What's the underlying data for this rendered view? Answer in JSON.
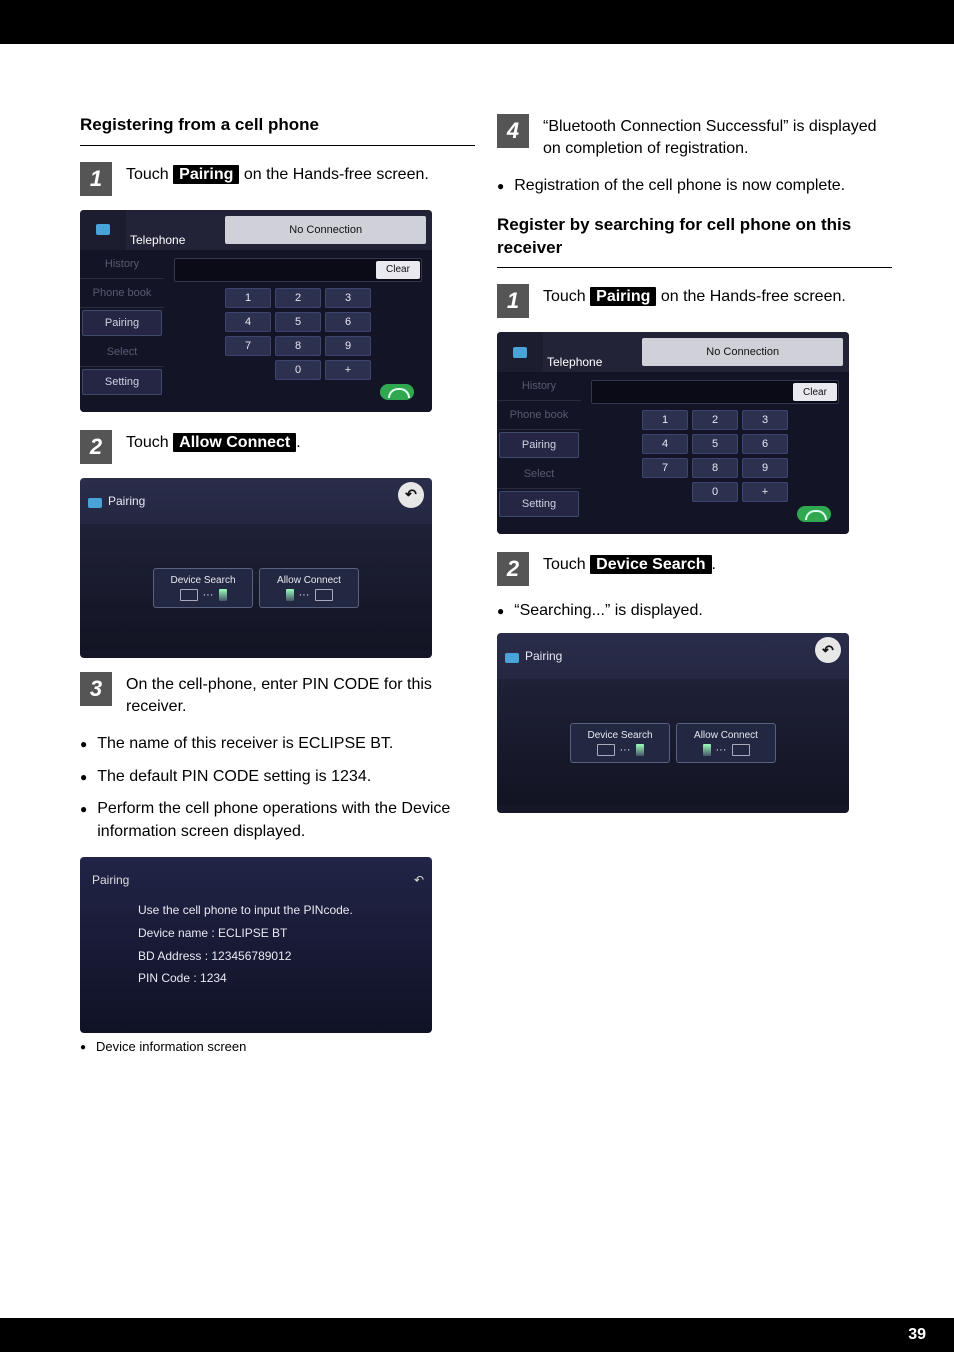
{
  "page_number": "39",
  "left": {
    "section_title": "Registering from a cell phone",
    "step1": {
      "num": "1",
      "pre": "Touch ",
      "chip": "Pairing",
      "post": " on the Hands-free screen."
    },
    "step2": {
      "num": "2",
      "pre": "Touch ",
      "chip": "Allow Connect",
      "post": "."
    },
    "step3": {
      "num": "3",
      "text": "On the cell-phone, enter PIN CODE for this receiver."
    },
    "bullets": [
      "The name of this receiver is ECLIPSE BT.",
      "The default PIN CODE setting is 1234.",
      "Perform the cell phone operations with the Device information screen displayed."
    ],
    "dev_caption": "Device information screen"
  },
  "right": {
    "step4": {
      "num": "4",
      "text": "“Bluetooth Connection Successful” is displayed on completion of registration."
    },
    "bullet_after4": "Registration of the cell phone is now complete.",
    "section_title": "Register by searching for cell phone on this receiver",
    "step1": {
      "num": "1",
      "pre": "Touch ",
      "chip": "Pairing",
      "post": " on the Hands-free screen."
    },
    "step2": {
      "num": "2",
      "pre": "Touch ",
      "chip": "Device Search",
      "post": "."
    },
    "bullet_after2": "“Searching...” is displayed."
  },
  "phone_ui": {
    "title": "Telephone",
    "no_connection": "No Connection",
    "side_items": [
      "History",
      "Phone book",
      "Pairing",
      "Select",
      "Setting"
    ],
    "clear": "Clear",
    "keys": [
      "1",
      "2",
      "3",
      "4",
      "5",
      "6",
      "7",
      "8",
      "9",
      "0",
      "+"
    ]
  },
  "pair_ui": {
    "title": "Pairing",
    "device_search": "Device Search",
    "allow_connect": "Allow Connect"
  },
  "dev_ui": {
    "title": "Pairing",
    "line1": "Use the cell phone to input the PINcode.",
    "line2": "Device name : ECLIPSE BT",
    "line3": "BD Address   : 123456789012",
    "line4": "PIN Code      : 1234"
  }
}
